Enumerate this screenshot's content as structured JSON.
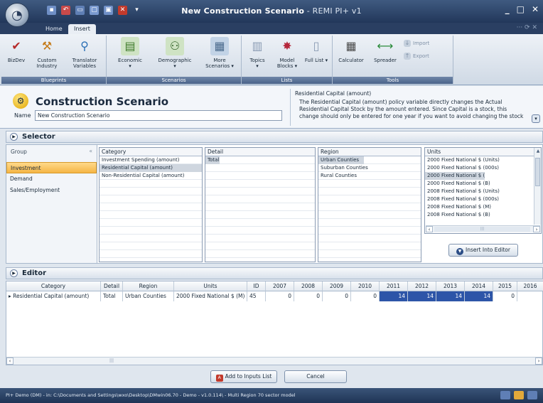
{
  "window": {
    "title": "New Construction Scenario",
    "title_suffix": " - REMI PI+ v1",
    "min_icon": "minimize-icon",
    "close_icon": "close-icon"
  },
  "tabs": [
    "Home",
    "Insert"
  ],
  "ribbon": {
    "groups": [
      {
        "label": "Blueprints",
        "buttons": [
          {
            "label": "BizDev",
            "icon": "bizdev-icon"
          },
          {
            "label": "Custom Industry",
            "icon": "custom-industry-icon"
          },
          {
            "label": "Translator Variables",
            "icon": "translator-variables-icon"
          }
        ]
      },
      {
        "label": "Scenarios",
        "buttons": [
          {
            "label": "Economic",
            "icon": "economic-icon"
          },
          {
            "label": "Demographic",
            "icon": "demographic-icon"
          },
          {
            "label": "More Scenarios",
            "icon": "more-scenarios-icon"
          }
        ]
      },
      {
        "label": "Lists",
        "buttons": [
          {
            "label": "Topics",
            "icon": "topics-icon"
          },
          {
            "label": "Model Blocks",
            "icon": "model-blocks-icon"
          },
          {
            "label": "Full List",
            "icon": "full-list-icon"
          }
        ]
      },
      {
        "label": "Tools",
        "buttons": [
          {
            "label": "Calculator",
            "icon": "calculator-icon"
          },
          {
            "label": "Spreader",
            "icon": "spreader-icon"
          },
          {
            "label": "Import",
            "icon": "import-icon"
          },
          {
            "label": "Export",
            "icon": "export-icon"
          }
        ]
      }
    ]
  },
  "header": {
    "title": "Construction Scenario",
    "name_label": "Name",
    "name_value": "New Construction Scenario",
    "desc_title": "Residential Capital (amount)",
    "desc_text": "The Residential Capital (amount) policy variable directly changes the Actual Residential Capital Stock by the amount entered.  Since Capital is a stock, this change should only be entered for one year if you want to avoid changing the stock"
  },
  "selector": {
    "label": "Selector",
    "group_header": "Group",
    "group_collapse": "«",
    "groups": [
      "Investment",
      "Demand",
      "Sales/Employment"
    ],
    "category": {
      "header": "Category",
      "items": [
        "Investment Spending (amount)",
        "Residential Capital (amount)",
        "Non-Residential Capital (amount)"
      ]
    },
    "detail": {
      "header": "Detail",
      "items": [
        "Total"
      ]
    },
    "region": {
      "header": "Region",
      "items": [
        "Urban Counties",
        "Suburban Counties",
        "Rural Counties"
      ]
    },
    "units": {
      "header": "Units",
      "items": [
        "2000 Fixed National $ (Units)",
        "2000 Fixed National $ (000s)",
        "2000 Fixed National $ (M)",
        "2000 Fixed National $ (B)",
        "2008 Fixed National $ (Units)",
        "2008 Fixed National $ (000s)",
        "2008 Fixed National $ (M)",
        "2008 Fixed National $ (B)"
      ]
    },
    "insert_button": "Insert Into Editor"
  },
  "editor": {
    "label": "Editor",
    "columns": [
      "Category",
      "Detail",
      "Region",
      "Units",
      "ID",
      "2007",
      "2008",
      "2009",
      "2010",
      "2011",
      "2012",
      "2013",
      "2014",
      "2015",
      "2016"
    ],
    "rows": [
      [
        "Residential Capital (amount)",
        "Total",
        "Urban Counties",
        "2000 Fixed National $ (M)",
        "45",
        "0",
        "0",
        "0",
        "0",
        "14",
        "14",
        "14",
        "14",
        "0",
        ""
      ]
    ],
    "add_button": "Add to Inputs List",
    "cancel_button": "Cancel"
  },
  "status": {
    "text": "PI+ Demo (DM) - in: C:\\Documents and Settings\\wxo\\Desktop\\DMwin06.70 - Demo - v1.0.114\\ - Multi Region 70 sector model"
  },
  "colors": {
    "title_bar": "#22375a",
    "selected_group": "#f5b545",
    "highlight_cell": "#2d55a8"
  }
}
